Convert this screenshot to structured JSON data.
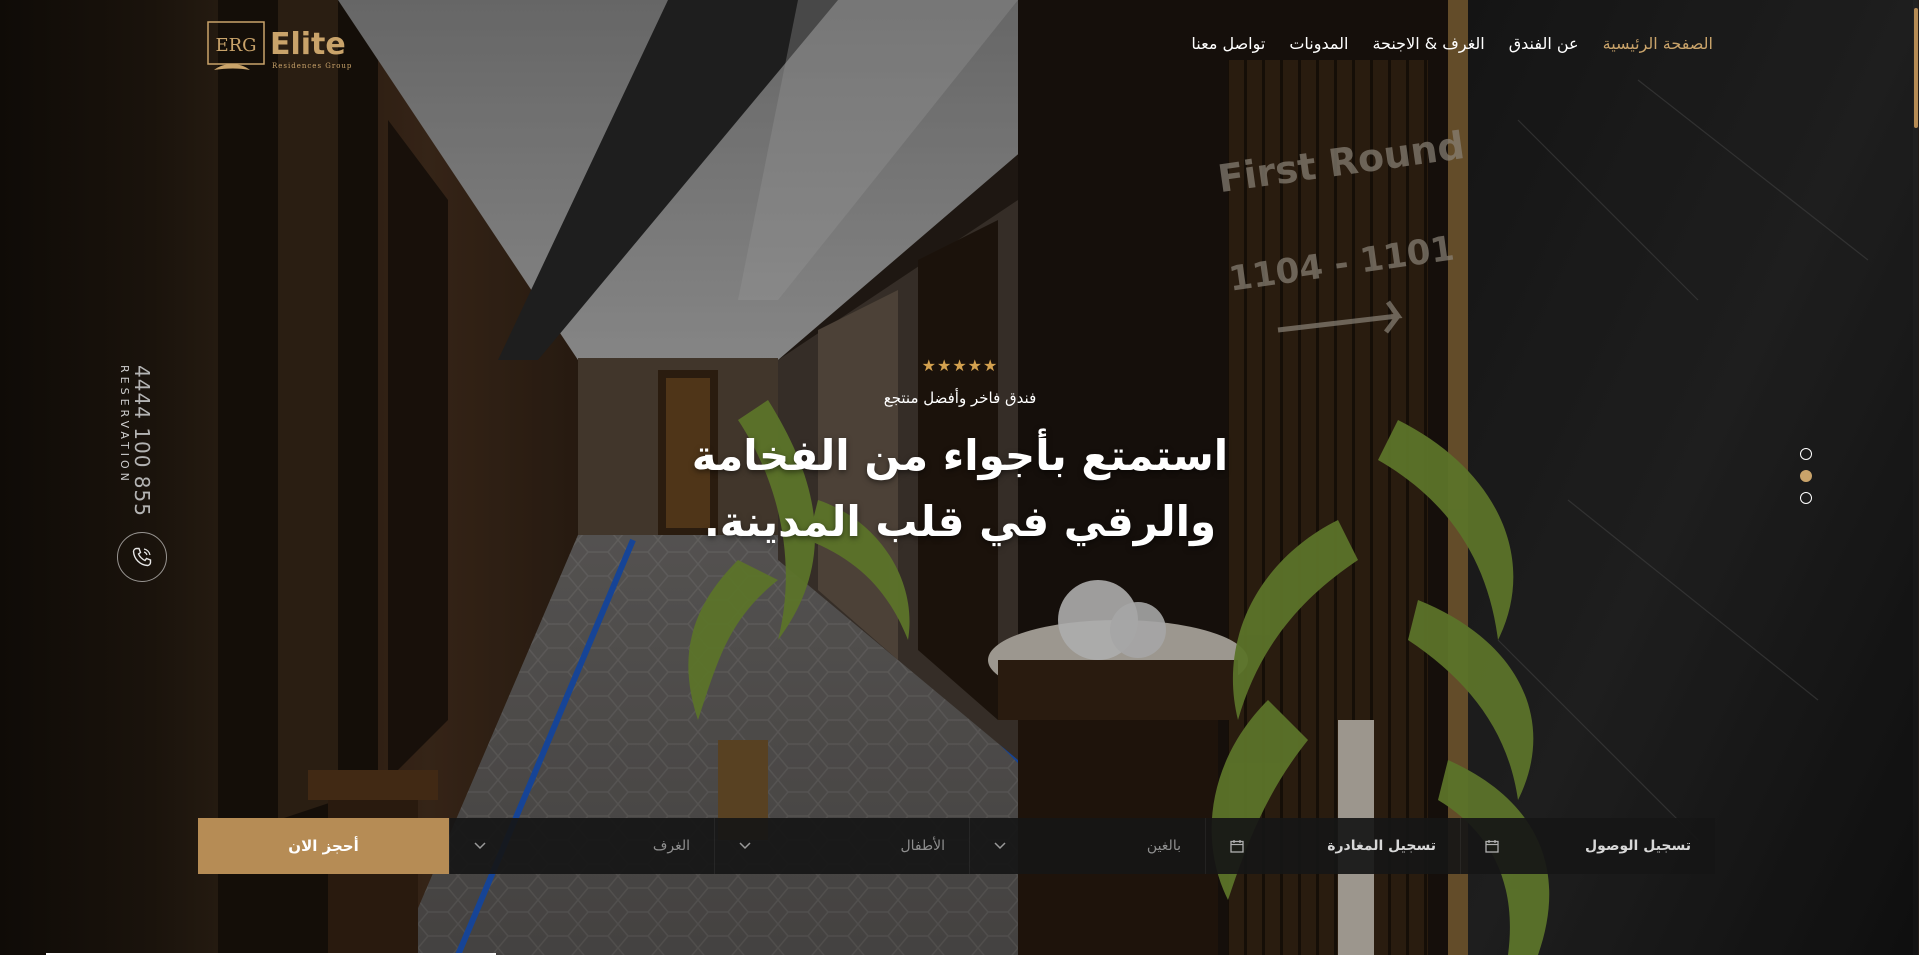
{
  "brand": {
    "logo_monogram": "ERG",
    "logo_word": "Elite",
    "logo_sub": "Residences Group",
    "gold": "#c9a36a"
  },
  "nav": {
    "items": [
      {
        "label": "الصفحة الرئيسية",
        "active": true
      },
      {
        "label": "عن الفندق",
        "active": false
      },
      {
        "label": "الغرف & الاجنحة",
        "active": false
      },
      {
        "label": "المدونات",
        "active": false
      },
      {
        "label": "تواصل معنا",
        "active": false
      }
    ]
  },
  "reservation": {
    "number": "4444 100 855",
    "label": "RESERVATION",
    "icon": "phone-icon"
  },
  "hero": {
    "stars": "★★★★★",
    "tagline": "فندق فاخر وأفضل منتجع",
    "headline_line1": "استمتع بأجواء من الفخامة",
    "headline_line2": "والرقي في قلب المدينة."
  },
  "slider": {
    "count": 3,
    "active_index": 1
  },
  "booking": {
    "checkin_label": "تسجيل الوصول",
    "checkout_label": "تسجيل المغادرة",
    "adults_label": "بالغين",
    "kids_label": "الأطفال",
    "rooms_label": "الغرف",
    "button_label": "أحجز الان",
    "button_color": "#b68c55"
  }
}
